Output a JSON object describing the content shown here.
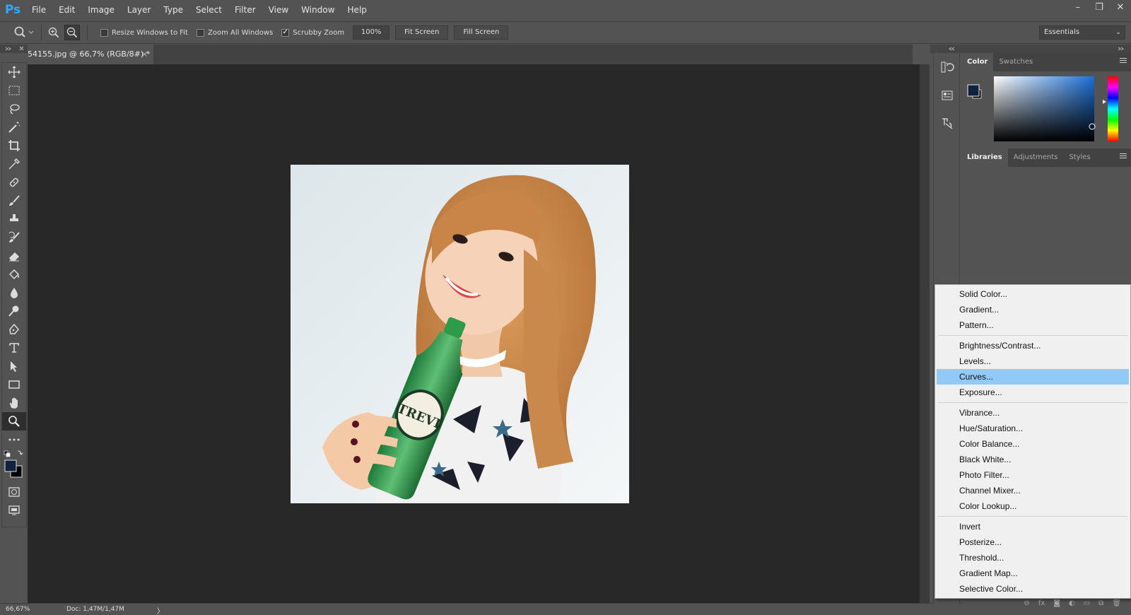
{
  "app": {
    "logo": "Ps"
  },
  "menu": [
    "File",
    "Edit",
    "Image",
    "Layer",
    "Type",
    "Select",
    "Filter",
    "View",
    "Window",
    "Help"
  ],
  "window_controls": [
    "–",
    "❐",
    "✕"
  ],
  "options": {
    "resize_windows": "Resize Windows to Fit",
    "zoom_all": "Zoom All Windows",
    "scrubby_zoom": "Scrubby Zoom",
    "zoom_value": "100%",
    "fit_screen": "Fit Screen",
    "fill_screen": "Fill Screen",
    "workspace": "Essentials"
  },
  "document": {
    "tab_title": "54155.jpg @ 66,7% (RGB/8#) *",
    "close": "×"
  },
  "status": {
    "zoom": "66,67%",
    "doc": "Doc: 1,47M/1,47M",
    "arrow": "〉"
  },
  "color_panel": {
    "tabs": [
      "Color",
      "Swatches"
    ],
    "fg_color": "#0f2340",
    "bg_color": "#000000",
    "picker_hue": "#1b6fd6"
  },
  "libs_panel": {
    "tabs": [
      "Libraries",
      "Adjustments",
      "Styles"
    ]
  },
  "context_menu": {
    "groups": [
      [
        "Solid Color...",
        "Gradient...",
        "Pattern..."
      ],
      [
        "Brightness/Contrast...",
        "Levels...",
        "Curves...",
        "Exposure..."
      ],
      [
        "Vibrance...",
        "Hue/Saturation...",
        "Color Balance...",
        "Black  White...",
        "Photo Filter...",
        "Channel Mixer...",
        "Color Lookup..."
      ],
      [
        "Invert",
        "Posterize...",
        "Threshold...",
        "Gradient Map...",
        "Selective Color..."
      ]
    ],
    "highlighted": "Curves..."
  },
  "colors": {
    "accent": "#31a8ff",
    "highlight": "#91c9f7"
  }
}
